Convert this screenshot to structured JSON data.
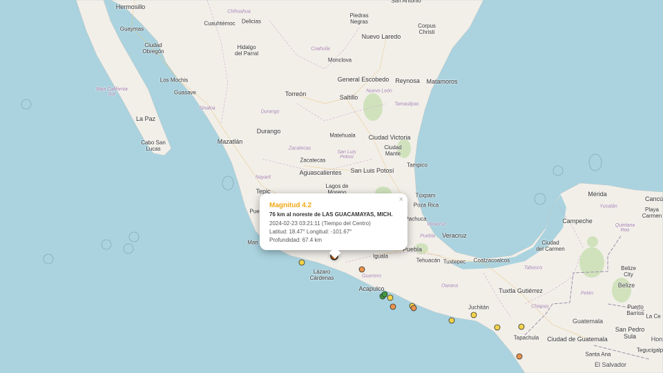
{
  "map": {
    "labels": {
      "hermosillo": "Hermosillo",
      "guaymas": "Guaymas",
      "ciudad_obregon": "Ciudad\nObregón",
      "los_mochis": "Los Mochis",
      "guasave": "Guasave",
      "baja_california_sur": "Baja California\nSur",
      "la_paz": "La Paz",
      "cabo_san_lucas": "Cabo San\nLucas",
      "chihuahua": "Chihuahua",
      "cuauhtemoc": "Cuauhtémoc",
      "delicias": "Delicias",
      "hidalgo_del_parral": "Hidalgo\ndel Parral",
      "sinaloa": "Sinaloa",
      "mazatlan": "Mazatlán",
      "durango_state": "Durango",
      "durango": "Durango",
      "torreon": "Torreón",
      "coahuila": "Coahuila",
      "monclova": "Monclova",
      "piedras_negras": "Piedras\nNegras",
      "san_antonio": "San Antonio",
      "corpus_christi": "Corpus\nChristi",
      "nuevo_laredo": "Nuevo Laredo",
      "general_escobedo": "General Escobedo",
      "nuevo_leon": "Nuevo León",
      "saltillo": "Saltillo",
      "reynosa": "Reynosa",
      "matamoros": "Matamoros",
      "tamaulipas": "Tamaulipas",
      "matehuala": "Matehuala",
      "ciudad_victoria": "Ciudad Victoria",
      "ciudad_mante": "Ciudad\nMante",
      "zacatecas_state": "Zacatecas",
      "san_luis_potosi_state": "San Luis\nPotosí",
      "zacatecas": "Zacatecas",
      "aguascalientes": "Aguascalientes",
      "san_luis_potosi": "San Luis Potosí",
      "tampico": "Tampico",
      "nayarit": "Nayarit",
      "tepic": "Tepic",
      "lagos_de_moreno": "Lagos de\nMoreno",
      "tuxpan": "Túxpam",
      "poza_rica": "Poza Rica",
      "pachuca": "Pachuca",
      "veracruz_state": "Veracruz",
      "puebla_state": "Puebla",
      "veracruz": "Veracruz",
      "puebla": "Puebla",
      "iguala": "Iguala",
      "guerrero": "Guerrero",
      "lazaro_cardenas": "Lázaro\nCárdenas",
      "acapulco": "Acapulco",
      "tehuacan": "Tehuacán",
      "tuxtepec": "Tuxtepec",
      "coatzacoalcos": "Coatzacoalcos",
      "oaxaca": "Oaxaca",
      "juchitan": "Juchitán",
      "tuxtla_gutierrez": "Tuxtla Gutiérrez",
      "chiapas": "Chiapas",
      "tabasco": "Tabasco",
      "ciudad_del_carmen": "Ciudad\ndel Carmen",
      "campeche": "Campeche",
      "merida": "Mérida",
      "yucatan": "Yucatán",
      "cancun": "Cancú",
      "playa_del_carmen": "Playa\nCarmen",
      "quintana_roo": "Quintana\nRoo",
      "peten": "Petén",
      "belize_city": "Belize\nCity",
      "belize": "Belize",
      "puerto_barrios": "Puerto\nBarrios",
      "la_ceiba": "La Ce",
      "guatemala": "Guatemala",
      "tapachula": "Tapachula",
      "ciudad_de_guatemala": "Ciudad de Guatemala",
      "san_pedro_sula": "San Pedro\nSula",
      "honduras": "Hon",
      "tegucigalpa": "Tegucigalp",
      "santa_ana": "Santa Ana",
      "el_salvador": "El Salvador",
      "manzanillo": "Man",
      "puerto_vallarta": "Puer"
    },
    "colors": {
      "water": "#aad3df",
      "land": "#f2efe9",
      "marker_yellow": "#f2d24a",
      "marker_orange": "#e8924a",
      "marker_green": "#3f9a3f",
      "marker_orange_red": "#e06b1a"
    },
    "markers": [
      {
        "level": "yellow"
      },
      {
        "level": "orange"
      },
      {
        "level": "green"
      },
      {
        "level": "green"
      },
      {
        "level": "yellow"
      },
      {
        "level": "orange"
      },
      {
        "level": "yellow"
      },
      {
        "level": "orange"
      },
      {
        "level": "yellow"
      },
      {
        "level": "yellow"
      },
      {
        "level": "yellow"
      },
      {
        "level": "yellow"
      },
      {
        "level": "orange"
      },
      {
        "level": "selected"
      }
    ]
  },
  "popup": {
    "title": "Magnitud 4.2",
    "place": "76 km al noreste de LAS GUACAMAYAS, MICH.",
    "datetime": "2024-02-23  03:21:11 (Tiempo del Centro)",
    "coords": "Latitud: 18.47°  Longitud: -101.67°",
    "depth": "Profundidad: 67.4 km",
    "close_icon": "×"
  }
}
